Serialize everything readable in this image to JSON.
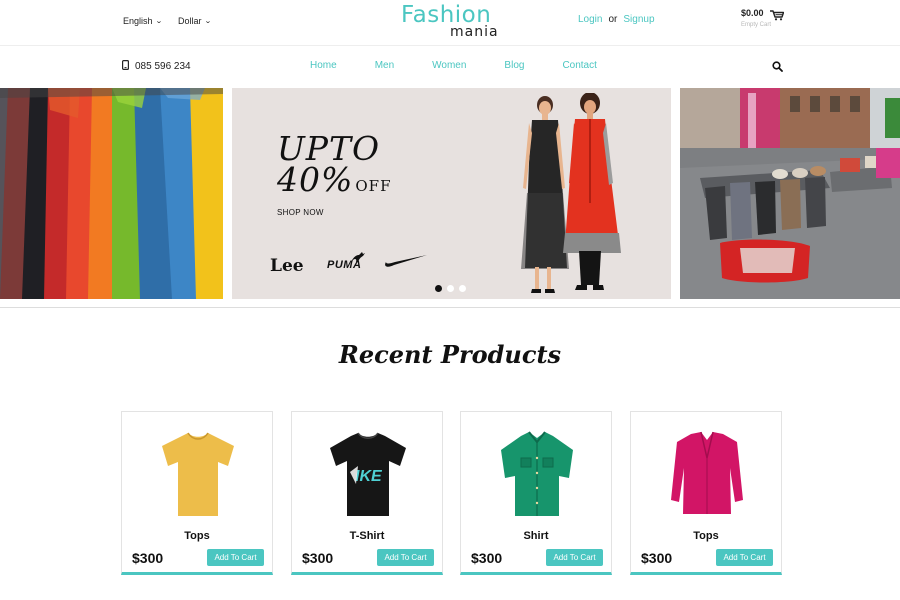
{
  "header": {
    "language": "English",
    "currency": "Dollar",
    "logo_main": "Fashion",
    "logo_sub": "mania",
    "login": "Login",
    "or": "or",
    "signup": "Signup",
    "cart_total": "$0.00",
    "cart_status": "Empty Cart",
    "cart_icon": "cart-icon"
  },
  "nav": {
    "phone": "085 596 234",
    "phone_icon": "phone-icon",
    "items": [
      "Home",
      "Men",
      "Women",
      "Blog",
      "Contact"
    ],
    "search_icon": "search-icon"
  },
  "banner": {
    "promo_line1": "UPTO",
    "promo_line2": "40%",
    "promo_off": "OFF",
    "shop_now": "SHOP NOW",
    "brands": [
      "Lee",
      "PUMA",
      "Nike"
    ],
    "slides": 3,
    "active_slide": 1
  },
  "products": {
    "title": "Recent Products",
    "items": [
      {
        "name": "Tops",
        "price": "$300",
        "button": "Add To Cart",
        "color": "#edbd4a"
      },
      {
        "name": "T-Shirt",
        "price": "$300",
        "button": "Add To Cart",
        "color": "#161616"
      },
      {
        "name": "Shirt",
        "price": "$300",
        "button": "Add To Cart",
        "color": "#17956c"
      },
      {
        "name": "Tops",
        "price": "$300",
        "button": "Add To Cart",
        "color": "#d21566"
      }
    ]
  },
  "colors": {
    "accent": "#4bc6c1",
    "text": "#222222"
  }
}
